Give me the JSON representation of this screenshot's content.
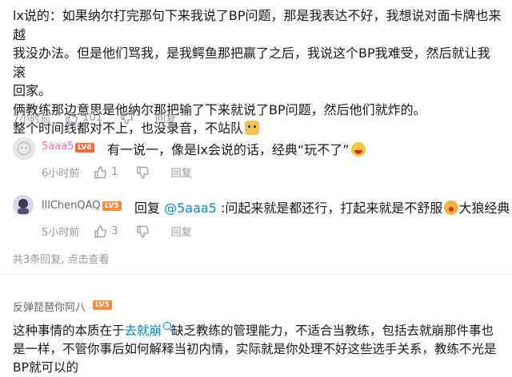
{
  "main_comment": {
    "lines": [
      "lx说的：如果纳尔打完那句下来我说了BP问题，那是我表达不好，我想说对面卡牌也来越",
      "我没办法。但是他们骂我，是我鳄鱼那把赢了之后，我说这个BP我难受，然后就让我滚",
      "回家。",
      "俩教练那边意思是他纳尔那把输了下来就说了BP问题，然后他们就炸的。",
      "整个时间线都对不上，也没录音，不站队"
    ],
    "emoji_icon": "dog-face-emoji",
    "time": "7小时前",
    "likes": "101",
    "reply_label": "回复"
  },
  "replies": [
    {
      "username": "5aaa5",
      "level": "LV6",
      "text": "有一说一，像是lx会说的话，经典“玩不了”",
      "emoji_icon": "laughing-emoji",
      "time": "6小时前",
      "likes": "1",
      "reply_label": "回复"
    },
    {
      "username": "lllChenQAQ",
      "level": "LV5",
      "reply_prefix": "回复",
      "mention": "@5aaa5",
      "text": ":问起来就是都还行，打起来就是不舒服",
      "emoji_icon": "crying-emoji",
      "text_after": "大狼经典",
      "time": "5小时前",
      "likes": "3",
      "reply_label": "回复"
    }
  ],
  "more_replies": "共3条回复, 点击查看",
  "second_comment": {
    "username": "反弹琵琶你阿八",
    "level": "LV5",
    "text_before_link": "这种事情的本质在于",
    "link_text": "去就崩",
    "text_line1_after": "缺乏教练的管理能力，不适合当教练，包括去就崩那件事也",
    "line2": "是一样，不管你事后如何解释当初内情，实际就是你处理不好这些选手关系，教练不光是",
    "line3": "BP就可以的"
  }
}
